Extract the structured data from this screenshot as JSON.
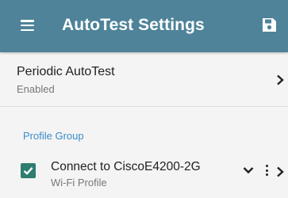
{
  "appbar": {
    "title": "AutoTest Settings",
    "menu_icon": "hamburger-menu-icon",
    "save_icon": "save-floppy-icon",
    "color": "#4e8399"
  },
  "periodic": {
    "label": "Periodic AutoTest",
    "status": "Enabled",
    "icon": "chevron-right-icon"
  },
  "profile_group": {
    "header": "Profile Group",
    "header_color": "#3a8dc8",
    "items": [
      {
        "name": "Connect to CiscoE4200-2G",
        "type": "Wi-Fi Profile",
        "checked": true,
        "icons": [
          "chevron-down-icon",
          "more-vertical-icon",
          "chevron-right-icon"
        ]
      }
    ]
  },
  "colors": {
    "checkbox": "#2e7d6e"
  }
}
